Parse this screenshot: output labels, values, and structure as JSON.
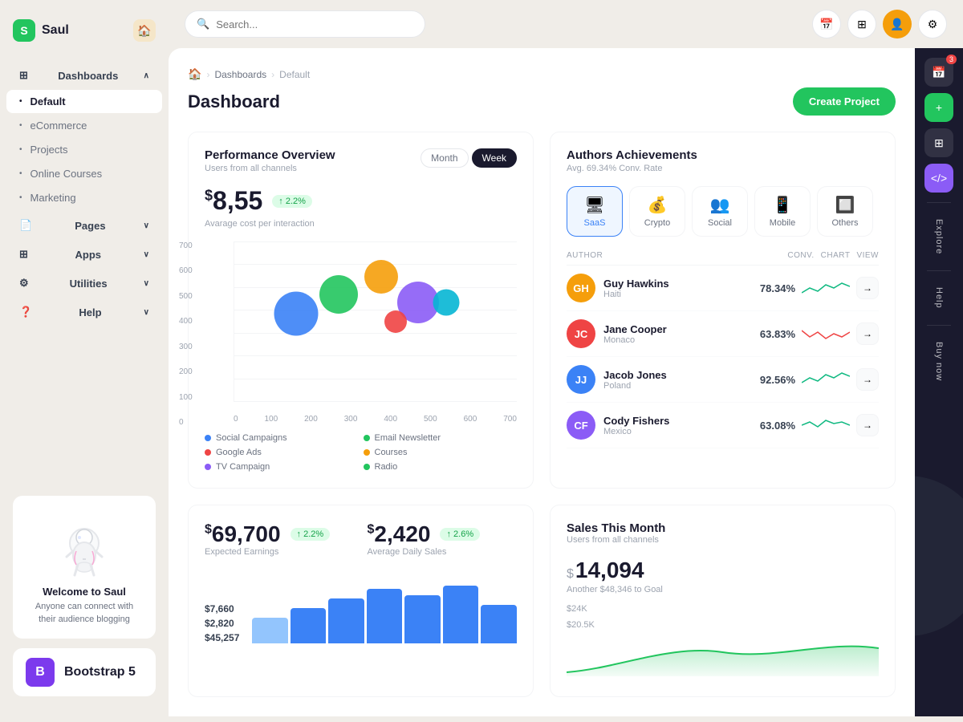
{
  "app": {
    "name": "Saul",
    "logo_letter": "S"
  },
  "topbar": {
    "search_placeholder": "Search...",
    "create_btn": "Create Project"
  },
  "breadcrumb": {
    "home": "🏠",
    "dashboards": "Dashboards",
    "current": "Default"
  },
  "page": {
    "title": "Dashboard"
  },
  "sidebar": {
    "items": [
      {
        "label": "Dashboards",
        "icon": "⊞",
        "expandable": true
      },
      {
        "label": "Default",
        "active": true
      },
      {
        "label": "eCommerce"
      },
      {
        "label": "Projects"
      },
      {
        "label": "Online Courses"
      },
      {
        "label": "Marketing"
      },
      {
        "label": "Pages",
        "icon": "📄",
        "expandable": true
      },
      {
        "label": "Apps",
        "icon": "⊞",
        "expandable": true
      },
      {
        "label": "Utilities",
        "icon": "⚙",
        "expandable": true
      },
      {
        "label": "Help",
        "icon": "❓",
        "expandable": true
      }
    ],
    "welcome": {
      "title": "Welcome to Saul",
      "subtitle": "Anyone can connect with their audience blogging"
    }
  },
  "performance": {
    "title": "Performance Overview",
    "subtitle": "Users from all channels",
    "tabs": [
      "Month",
      "Week"
    ],
    "active_tab": "Month",
    "value": "8,55",
    "currency": "$",
    "badge": "2.2%",
    "metric_label": "Avarage cost per interaction",
    "y_axis": [
      "700",
      "600",
      "500",
      "400",
      "300",
      "200",
      "100",
      "0"
    ],
    "x_axis": [
      "0",
      "100",
      "200",
      "300",
      "400",
      "500",
      "600",
      "700"
    ],
    "bubbles": [
      {
        "x": 22,
        "y": 55,
        "size": 50,
        "color": "#3b82f6",
        "label": "Social Campaigns"
      },
      {
        "x": 37,
        "y": 43,
        "size": 42,
        "color": "#22c55e",
        "label": "Email Newsletter"
      },
      {
        "x": 52,
        "y": 30,
        "size": 38,
        "color": "#f59e0b",
        "label": "Courses"
      },
      {
        "x": 65,
        "y": 48,
        "size": 48,
        "color": "#8b5cf6",
        "label": "TV Campaign"
      },
      {
        "x": 57,
        "y": 55,
        "size": 25,
        "color": "#ef4444",
        "label": "Google Ads"
      },
      {
        "x": 75,
        "y": 48,
        "size": 30,
        "color": "#06b6d4",
        "label": "Radio"
      }
    ],
    "legend": [
      {
        "label": "Social Campaigns",
        "color": "#3b82f6"
      },
      {
        "label": "Email Newsletter",
        "color": "#22c55e"
      },
      {
        "label": "Google Ads",
        "color": "#ef4444"
      },
      {
        "label": "Courses",
        "color": "#f59e0b"
      },
      {
        "label": "TV Campaign",
        "color": "#8b5cf6"
      },
      {
        "label": "Radio",
        "color": "#22c55e"
      }
    ]
  },
  "authors": {
    "title": "Authors Achievements",
    "subtitle": "Avg. 69.34% Conv. Rate",
    "tabs": [
      {
        "label": "SaaS",
        "icon": "🖥",
        "active": true
      },
      {
        "label": "Crypto",
        "icon": "💰"
      },
      {
        "label": "Social",
        "icon": "👥"
      },
      {
        "label": "Mobile",
        "icon": "📱"
      },
      {
        "label": "Others",
        "icon": "🔲"
      }
    ],
    "table_headers": [
      "AUTHOR",
      "CONV.",
      "CHART",
      "VIEW"
    ],
    "rows": [
      {
        "name": "Guy Hawkins",
        "location": "Haiti",
        "conv": "78.34%",
        "color": "#f59e0b",
        "chart_color": "#10b981"
      },
      {
        "name": "Jane Cooper",
        "location": "Monaco",
        "conv": "63.83%",
        "color": "#ef4444",
        "chart_color": "#ef4444"
      },
      {
        "name": "Jacob Jones",
        "location": "Poland",
        "conv": "92.56%",
        "color": "#3b82f6",
        "chart_color": "#10b981"
      },
      {
        "name": "Cody Fishers",
        "location": "Mexico",
        "conv": "63.08%",
        "color": "#8b5cf6",
        "chart_color": "#10b981"
      }
    ]
  },
  "stats": {
    "earnings": {
      "value": "69,700",
      "currency": "$",
      "badge": "2.2%",
      "label": "Expected Earnings"
    },
    "daily_sales": {
      "value": "2,420",
      "currency": "$",
      "badge": "2.6%",
      "label": "Average Daily Sales"
    },
    "values": [
      "$7,660",
      "$2,820",
      "$45,257"
    ]
  },
  "sales": {
    "title": "Sales This Month",
    "subtitle": "Users from all channels",
    "value": "14,094",
    "currency": "$",
    "goal_label": "Another $48,346 to Goal",
    "y_labels": [
      "$24K",
      "$20.5K"
    ]
  },
  "right_panel": {
    "labels": [
      "Explore",
      "Help",
      "Buy now"
    ]
  }
}
